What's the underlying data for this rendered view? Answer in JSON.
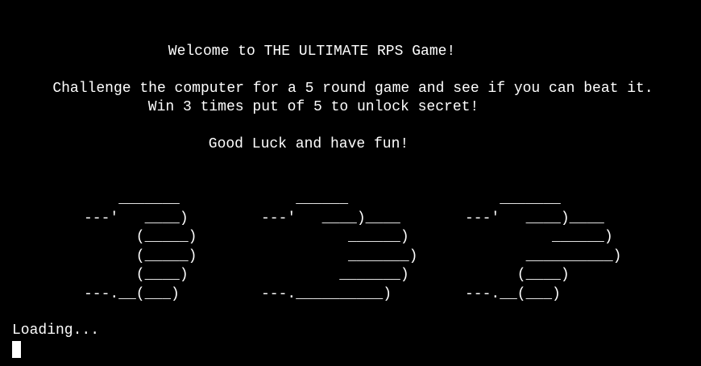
{
  "terminal": {
    "welcome": "Welcome to THE ULTIMATE RPS Game!",
    "challenge": "Challenge the computer for a 5 round game and see if you can beat it.",
    "win_message": "Win 3 times put of 5 to unlock secret!",
    "good_luck": "Good Luck and have fun!",
    "loading": "Loading..."
  },
  "ascii_art": {
    "rock": "    _______\n---'   ____)\n      (_____)\n      (_____)\n      (____)\n---.__(___)",
    "paper": "    ______\n---'   ____)____\n          ______)\n          _______)\n         _______)\n---.__________)",
    "scissors": "    _______\n---'   ____)____\n          ______)\n       __________)\n      (____)\n---.__(___)"
  },
  "colors": {
    "background": "#000000",
    "text": "#ffffff"
  }
}
